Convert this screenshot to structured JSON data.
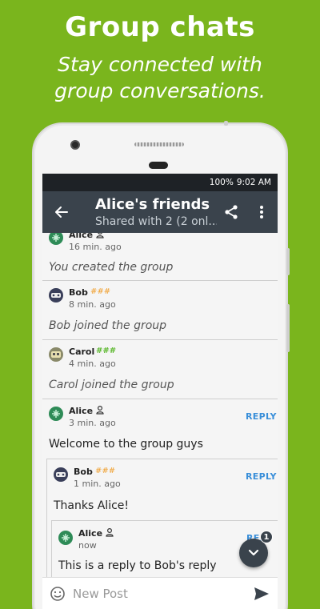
{
  "promo": {
    "title": "Group chats",
    "subtitle_line1": "Stay connected with",
    "subtitle_line2": "group conversations."
  },
  "status_bar": {
    "battery": "100%",
    "time": "9:02 AM"
  },
  "app_bar": {
    "title": "Alice's friends",
    "subtitle": "Shared with 2 (2 onl..."
  },
  "posts": [
    {
      "author": "Alice",
      "time": "16 min. ago",
      "text": "You created the group",
      "icon": "person-icon"
    },
    {
      "author": "Bob",
      "time": "8 min. ago",
      "text": "Bob joined the group",
      "badge": "###"
    },
    {
      "author": "Carol",
      "time": "4 min. ago",
      "text": "Carol joined the group",
      "badge": "###"
    },
    {
      "author": "Alice",
      "time": "3 min. ago",
      "text": "Welcome to the group guys",
      "action": "REPLY",
      "icon": "person-icon"
    },
    {
      "author": "Bob",
      "time": "1 min. ago",
      "text": "Thanks Alice!",
      "action": "REPLY",
      "badge": "###"
    },
    {
      "author": "Alice",
      "time": "now",
      "text": "This is a reply to Bob's reply",
      "action": "REP",
      "icon": "person-icon"
    }
  ],
  "composer": {
    "placeholder": "New Post"
  },
  "fab": {
    "unread_count": "1"
  },
  "colors": {
    "background": "#7ab51d",
    "app_bar": "#3a434c",
    "status_bar": "#1e2226",
    "reply_link": "#3a8fd9",
    "badge_bob": "#f0a030",
    "badge_carol": "#5cb82e"
  }
}
